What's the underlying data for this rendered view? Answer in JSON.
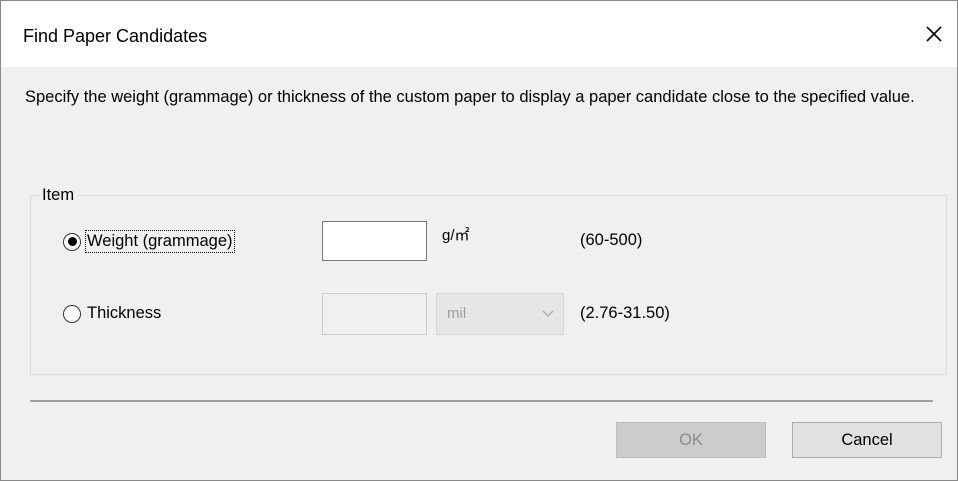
{
  "dialog": {
    "title": "Find Paper Candidates",
    "close_icon": "close-icon"
  },
  "description": "Specify the weight (grammage) or thickness of the custom paper to display a paper candidate close to the specified value.",
  "item_group": {
    "label": "Item",
    "weight": {
      "label": "Weight (grammage)",
      "selected": true,
      "value": "",
      "unit": "g/㎡",
      "range": "(60-500)"
    },
    "thickness": {
      "label": "Thickness",
      "selected": false,
      "value": "",
      "unit_selected": "mil",
      "range": "(2.76-31.50)",
      "disabled": true
    }
  },
  "buttons": {
    "ok": "OK",
    "ok_disabled": true,
    "cancel": "Cancel"
  },
  "colors": {
    "title_bar": "#ffffff",
    "dialog_bg": "#f0f0f0",
    "disabled_button": "#cccccc",
    "disabled_text": "#8c8c8c"
  }
}
